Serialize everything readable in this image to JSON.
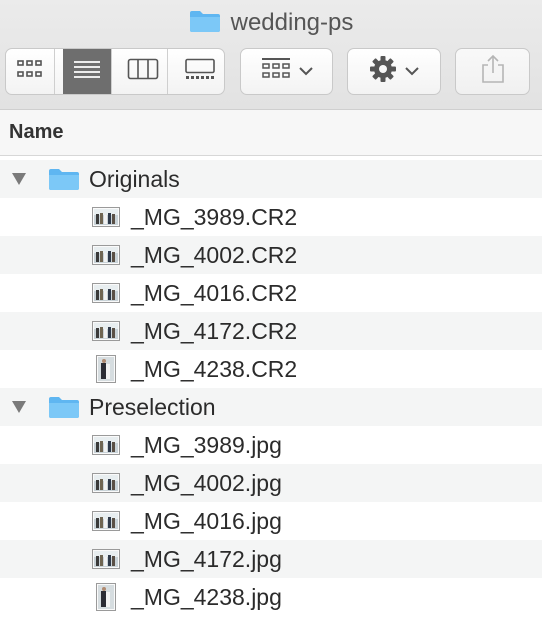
{
  "window": {
    "title": "wedding-ps",
    "title_icon": "folder-icon"
  },
  "toolbar": {
    "view_modes": [
      {
        "name": "icon-view",
        "icon": "grid-icon",
        "active": false
      },
      {
        "name": "list-view",
        "icon": "list-icon",
        "active": true
      },
      {
        "name": "column-view",
        "icon": "columns-icon",
        "active": false
      },
      {
        "name": "gallery-view",
        "icon": "gallery-icon",
        "active": false
      }
    ],
    "group_icon": "group-grid-icon",
    "action_icon": "gear-icon",
    "share_icon": "share-icon"
  },
  "list": {
    "column_header": "Name",
    "rows": [
      {
        "type": "folder",
        "label": "Originals",
        "expanded": true
      },
      {
        "type": "file",
        "label": "_MG_3989.CR2",
        "orientation": "landscape"
      },
      {
        "type": "file",
        "label": "_MG_4002.CR2",
        "orientation": "landscape"
      },
      {
        "type": "file",
        "label": "_MG_4016.CR2",
        "orientation": "landscape"
      },
      {
        "type": "file",
        "label": "_MG_4172.CR2",
        "orientation": "landscape"
      },
      {
        "type": "file",
        "label": "_MG_4238.CR2",
        "orientation": "portrait"
      },
      {
        "type": "folder",
        "label": "Preselection",
        "expanded": true
      },
      {
        "type": "file",
        "label": "_MG_3989.jpg",
        "orientation": "landscape"
      },
      {
        "type": "file",
        "label": "_MG_4002.jpg",
        "orientation": "landscape"
      },
      {
        "type": "file",
        "label": "_MG_4016.jpg",
        "orientation": "landscape"
      },
      {
        "type": "file",
        "label": "_MG_4172.jpg",
        "orientation": "landscape"
      },
      {
        "type": "file",
        "label": "_MG_4238.jpg",
        "orientation": "portrait"
      }
    ]
  },
  "colors": {
    "folder_blue": "#6fc0f5",
    "active_segment": "#6e6e6e",
    "row_stripe": "#f4f5f5"
  }
}
